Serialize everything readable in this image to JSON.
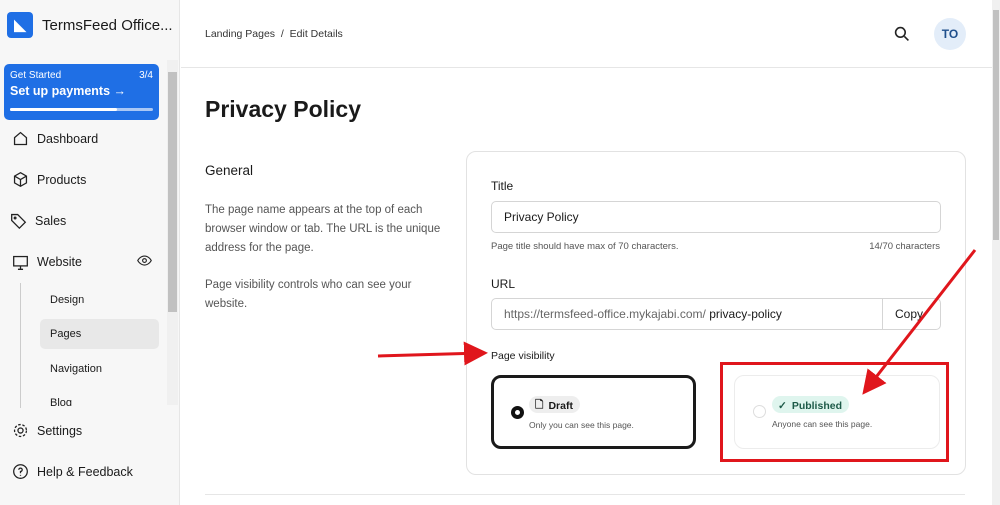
{
  "sidebar": {
    "site_name": "TermsFeed Office...",
    "get_started": {
      "label": "Get Started",
      "step": "3/4",
      "title": "Set up payments",
      "progress": 0.75
    },
    "items": [
      {
        "label": "Dashboard",
        "icon": "home-icon"
      },
      {
        "label": "Products",
        "icon": "box-icon"
      },
      {
        "label": "Sales",
        "icon": "tag-icon"
      },
      {
        "label": "Website",
        "icon": "monitor-icon"
      },
      {
        "label": "Settings",
        "icon": "gear-icon"
      },
      {
        "label": "Help & Feedback",
        "icon": "help-icon"
      }
    ],
    "website_sub": [
      "Design",
      "Pages",
      "Navigation",
      "Blog"
    ],
    "active_sub": "Pages"
  },
  "header": {
    "breadcrumb": [
      "Landing Pages",
      "Edit Details"
    ],
    "separator": "/",
    "avatar": "TO"
  },
  "page": {
    "title": "Privacy Policy",
    "section": "General",
    "desc1": "The page name appears at the top of each browser window or tab. The URL is the unique address for the page.",
    "desc2": "Page visibility controls who can see your website."
  },
  "form": {
    "title_label": "Title",
    "title_value": "Privacy Policy",
    "title_hint": "Page title should have max of 70 characters.",
    "title_count": "14/70 characters",
    "url_label": "URL",
    "url_prefix": "https://termsfeed-office.mykajabi.com/",
    "url_slug": "privacy-policy",
    "copy": "Copy",
    "visibility_label": "Page visibility",
    "options": [
      {
        "label": "Draft",
        "sub": "Only you can see this page.",
        "selected": true
      },
      {
        "label": "Published",
        "sub": "Anyone can see this page.",
        "selected": false
      }
    ]
  },
  "colors": {
    "accent": "#1f6fe5",
    "annotation": "#e0161c",
    "published_bg": "#dff5ee"
  }
}
